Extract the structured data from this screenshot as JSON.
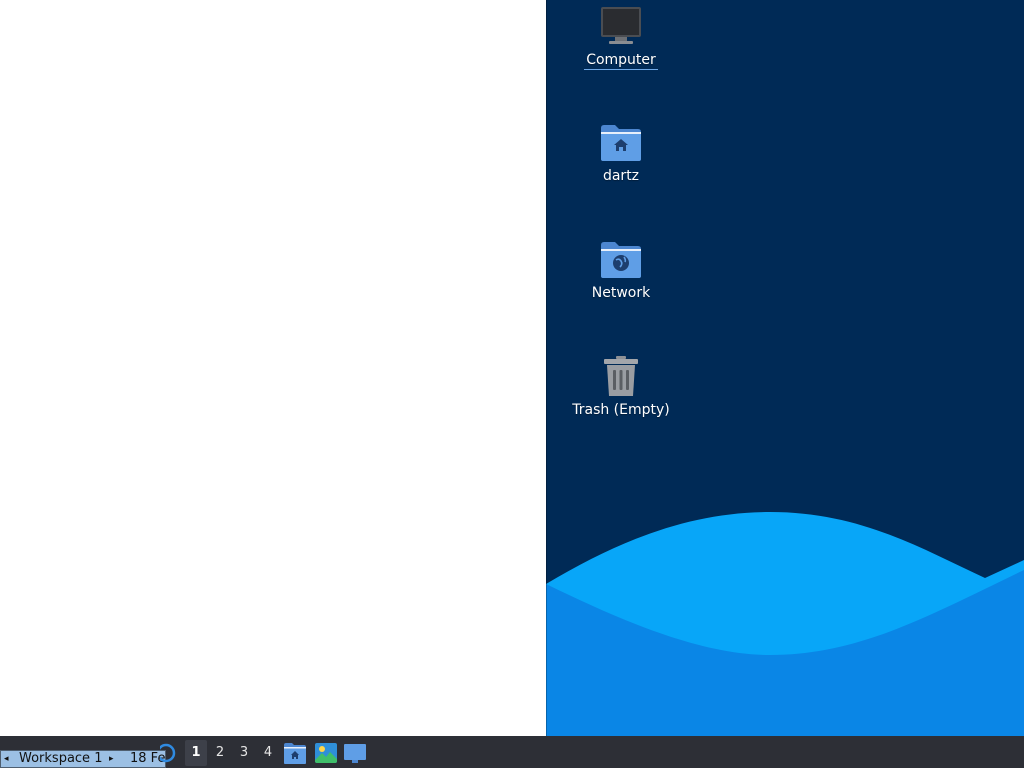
{
  "desktop": {
    "icons": [
      {
        "label": "Computer",
        "icon": "computer-icon"
      },
      {
        "label": "dartz",
        "icon": "home-folder-icon"
      },
      {
        "label": "Network",
        "icon": "network-folder-icon"
      },
      {
        "label": "Trash (Empty)",
        "icon": "trash-icon"
      }
    ]
  },
  "taskbar": {
    "workspace_name": {
      "prev_arrow": "◂",
      "label": "Workspace 1",
      "next_arrow": "▸",
      "date": "18 Fe"
    },
    "workspaces": [
      {
        "label": "1",
        "active": true
      },
      {
        "label": "2",
        "active": false
      },
      {
        "label": "3",
        "active": false
      },
      {
        "label": "4",
        "active": false
      }
    ],
    "launchers": [
      "file-manager-icon",
      "image-viewer-icon",
      "show-desktop-icon"
    ],
    "start_menu_icon": "start-menu-icon"
  },
  "colors": {
    "wallpaper_dark": "#002a56",
    "wave_light": "#00b0ff",
    "wave_mid": "#0a8ae8",
    "taskbar": "#2d2f36",
    "folder_blue": "#5f9ee6"
  }
}
